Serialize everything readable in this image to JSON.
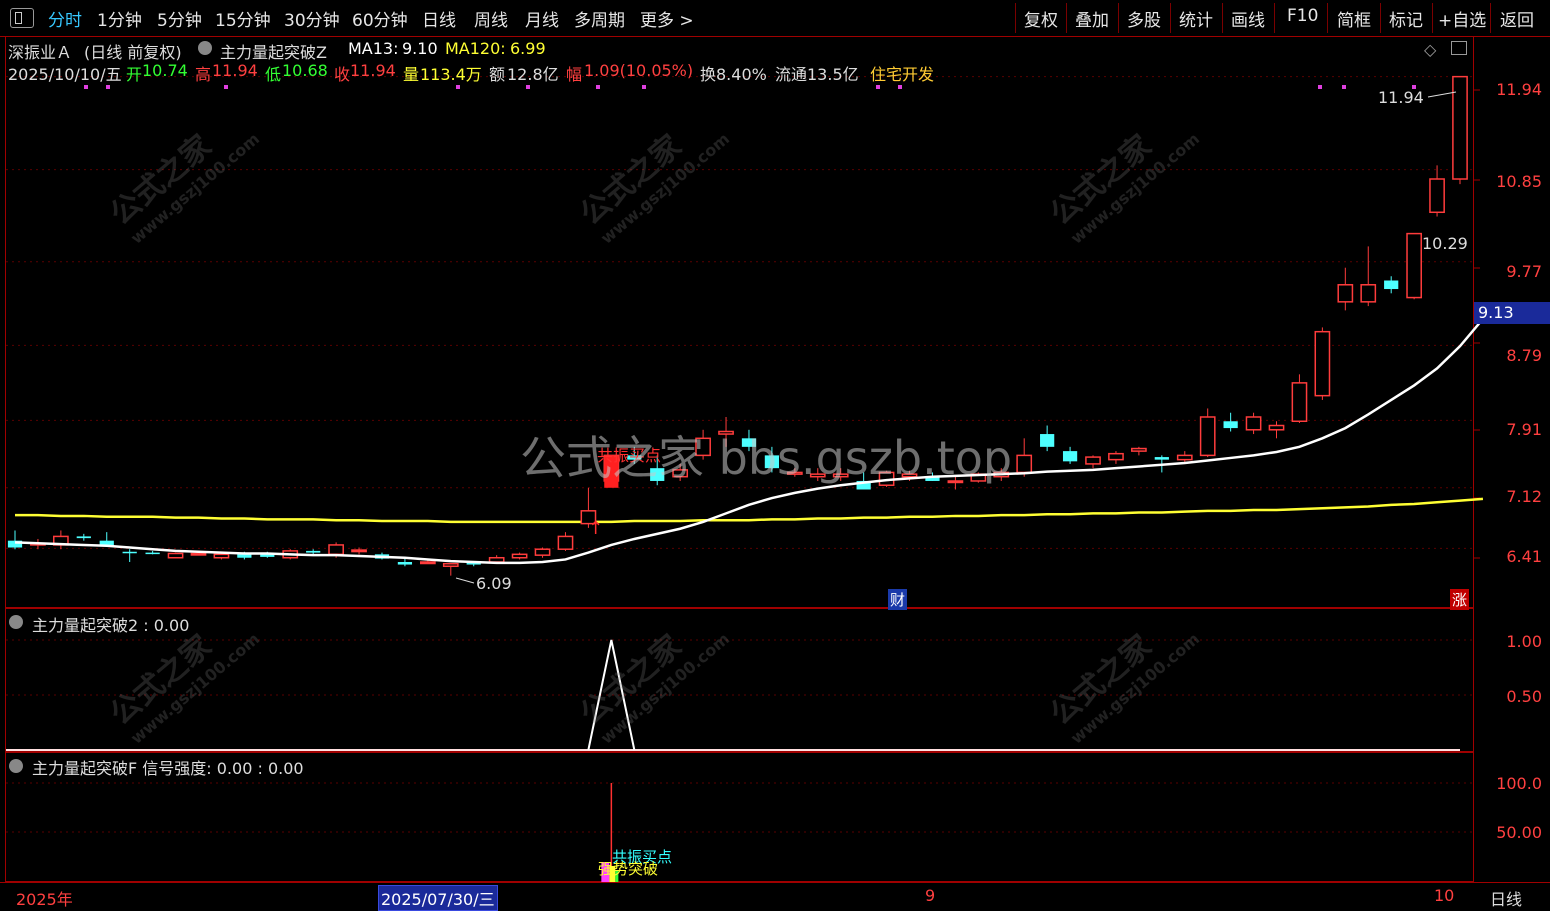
{
  "toolbar": {
    "left": [
      "分时",
      "1分钟",
      "5分钟",
      "15分钟",
      "30分钟",
      "60分钟",
      "日线",
      "周线",
      "月线",
      "多周期",
      "更多 >"
    ],
    "right": [
      "复权",
      "叠加",
      "多股",
      "统计",
      "画线",
      "F10",
      "简框",
      "标记",
      "+自选",
      "返回"
    ]
  },
  "header": {
    "stock_name": "深振业Ａ",
    "period": "(日线 前复权)",
    "indicator": "主力量起突破Z",
    "ma13_label": "MA13:",
    "ma13_value": "9.10",
    "ma120_label": "MA120:",
    "ma120_value": "6.99",
    "date": "2025/10/10/五",
    "open_label": "开",
    "open": "10.74",
    "high_label": "高",
    "high": "11.94",
    "low_label": "低",
    "low": "10.68",
    "close_label": "收",
    "close": "11.94",
    "vol_label": "量",
    "vol": "113.4万",
    "amt_label": "额",
    "amt": "12.8亿",
    "chg_label": "幅",
    "chg": "1.09(10.05%)",
    "turnover": "换8.40%",
    "float": "流通13.5亿",
    "sector": "住宅开发"
  },
  "axis": {
    "main": [
      "11.94",
      "10.85",
      "9.77",
      "8.79",
      "7.91",
      "7.12",
      "6.41"
    ],
    "current": "9.13",
    "ind1": [
      "1.00",
      "0.50"
    ],
    "ind2": [
      "100.0",
      "50.00"
    ]
  },
  "annotations": {
    "high_mark": "11.94",
    "low_mark": "6.09",
    "mid_mark": "10.29",
    "buy_label": "共振买点",
    "cai": "财",
    "zhang": "涨"
  },
  "ind1": {
    "title": "主力量起突破2 : 0.00"
  },
  "ind2": {
    "title": "主力量起突破F 信号强度: 0.00 : 0.00",
    "label_a": "共振买点",
    "label_b": "强势突破"
  },
  "bottom": {
    "year": "2025年",
    "cursor_date": "2025/07/30/三",
    "m9": "9",
    "m10": "10",
    "period": "日线"
  },
  "watermark": {
    "center": "公式之家 bbs.gszb.top",
    "tile": "公式之家",
    "tile_url": "www.gszj100.com"
  },
  "colors": {
    "up": "#ff3c3c",
    "down": "#4dffff",
    "ma13": "#ffffff",
    "ma120": "#ffff33",
    "frame": "#a00000"
  },
  "chart_data": {
    "type": "candlestick",
    "series": [
      {
        "o": 6.5,
        "h": 6.62,
        "l": 6.4,
        "c": 6.42
      },
      {
        "o": 6.45,
        "h": 6.52,
        "l": 6.4,
        "c": 6.47
      },
      {
        "o": 6.45,
        "h": 6.62,
        "l": 6.4,
        "c": 6.55
      },
      {
        "o": 6.55,
        "h": 6.58,
        "l": 6.5,
        "c": 6.53
      },
      {
        "o": 6.5,
        "h": 6.6,
        "l": 6.44,
        "c": 6.44
      },
      {
        "o": 6.37,
        "h": 6.4,
        "l": 6.25,
        "c": 6.36
      },
      {
        "o": 6.36,
        "h": 6.38,
        "l": 6.34,
        "c": 6.35
      },
      {
        "o": 6.3,
        "h": 6.36,
        "l": 6.3,
        "c": 6.35
      },
      {
        "o": 6.35,
        "h": 6.37,
        "l": 6.33,
        "c": 6.35
      },
      {
        "o": 6.3,
        "h": 6.37,
        "l": 6.28,
        "c": 6.34
      },
      {
        "o": 6.35,
        "h": 6.37,
        "l": 6.28,
        "c": 6.3
      },
      {
        "o": 6.34,
        "h": 6.37,
        "l": 6.3,
        "c": 6.31
      },
      {
        "o": 6.3,
        "h": 6.4,
        "l": 6.28,
        "c": 6.38
      },
      {
        "o": 6.38,
        "h": 6.4,
        "l": 6.34,
        "c": 6.36
      },
      {
        "o": 6.34,
        "h": 6.48,
        "l": 6.3,
        "c": 6.45
      },
      {
        "o": 6.38,
        "h": 6.42,
        "l": 6.34,
        "c": 6.39
      },
      {
        "o": 6.34,
        "h": 6.36,
        "l": 6.28,
        "c": 6.29
      },
      {
        "o": 6.25,
        "h": 6.3,
        "l": 6.2,
        "c": 6.22
      },
      {
        "o": 6.25,
        "h": 6.27,
        "l": 6.23,
        "c": 6.25
      },
      {
        "o": 6.2,
        "h": 6.23,
        "l": 6.09,
        "c": 6.23
      },
      {
        "o": 6.24,
        "h": 6.26,
        "l": 6.2,
        "c": 6.22
      },
      {
        "o": 6.25,
        "h": 6.33,
        "l": 6.24,
        "c": 6.3
      },
      {
        "o": 6.3,
        "h": 6.36,
        "l": 6.28,
        "c": 6.34
      },
      {
        "o": 6.33,
        "h": 6.42,
        "l": 6.3,
        "c": 6.4
      },
      {
        "o": 6.4,
        "h": 6.6,
        "l": 6.38,
        "c": 6.55
      },
      {
        "o": 6.7,
        "h": 7.12,
        "l": 6.65,
        "c": 6.85
      },
      {
        "o": 7.2,
        "h": 7.5,
        "l": 7.15,
        "c": 7.5
      },
      {
        "o": 7.5,
        "h": 7.6,
        "l": 7.4,
        "c": 7.45
      },
      {
        "o": 7.35,
        "h": 7.5,
        "l": 7.15,
        "c": 7.2
      },
      {
        "o": 7.25,
        "h": 7.4,
        "l": 7.2,
        "c": 7.33
      },
      {
        "o": 7.5,
        "h": 7.8,
        "l": 7.45,
        "c": 7.7
      },
      {
        "o": 7.75,
        "h": 7.95,
        "l": 7.6,
        "c": 7.78
      },
      {
        "o": 7.7,
        "h": 7.8,
        "l": 7.55,
        "c": 7.6
      },
      {
        "o": 7.5,
        "h": 7.6,
        "l": 7.3,
        "c": 7.35
      },
      {
        "o": 7.28,
        "h": 7.35,
        "l": 7.25,
        "c": 7.3
      },
      {
        "o": 7.25,
        "h": 7.35,
        "l": 7.2,
        "c": 7.28
      },
      {
        "o": 7.25,
        "h": 7.35,
        "l": 7.2,
        "c": 7.28
      },
      {
        "o": 7.2,
        "h": 7.3,
        "l": 7.1,
        "c": 7.1
      },
      {
        "o": 7.15,
        "h": 7.32,
        "l": 7.13,
        "c": 7.3
      },
      {
        "o": 7.25,
        "h": 7.32,
        "l": 7.2,
        "c": 7.28
      },
      {
        "o": 7.25,
        "h": 7.3,
        "l": 7.2,
        "c": 7.2
      },
      {
        "o": 7.2,
        "h": 7.25,
        "l": 7.1,
        "c": 7.2
      },
      {
        "o": 7.2,
        "h": 7.3,
        "l": 7.18,
        "c": 7.28
      },
      {
        "o": 7.25,
        "h": 7.35,
        "l": 7.2,
        "c": 7.3
      },
      {
        "o": 7.3,
        "h": 7.7,
        "l": 7.25,
        "c": 7.5
      },
      {
        "o": 7.75,
        "h": 7.85,
        "l": 7.55,
        "c": 7.6
      },
      {
        "o": 7.55,
        "h": 7.6,
        "l": 7.4,
        "c": 7.43
      },
      {
        "o": 7.4,
        "h": 7.5,
        "l": 7.35,
        "c": 7.48
      },
      {
        "o": 7.45,
        "h": 7.55,
        "l": 7.4,
        "c": 7.52
      },
      {
        "o": 7.55,
        "h": 7.6,
        "l": 7.5,
        "c": 7.58
      },
      {
        "o": 7.48,
        "h": 7.5,
        "l": 7.3,
        "c": 7.45
      },
      {
        "o": 7.45,
        "h": 7.55,
        "l": 7.4,
        "c": 7.5
      },
      {
        "o": 7.5,
        "h": 8.05,
        "l": 7.48,
        "c": 7.95
      },
      {
        "o": 7.9,
        "h": 8.0,
        "l": 7.78,
        "c": 7.82
      },
      {
        "o": 7.8,
        "h": 8.0,
        "l": 7.75,
        "c": 7.95
      },
      {
        "o": 7.8,
        "h": 7.9,
        "l": 7.7,
        "c": 7.85
      },
      {
        "o": 7.9,
        "h": 8.45,
        "l": 7.88,
        "c": 8.35
      },
      {
        "o": 8.2,
        "h": 9.0,
        "l": 8.15,
        "c": 8.95
      },
      {
        "o": 9.3,
        "h": 9.7,
        "l": 9.2,
        "c": 9.5
      },
      {
        "o": 9.3,
        "h": 9.95,
        "l": 9.25,
        "c": 9.5
      },
      {
        "o": 9.55,
        "h": 9.6,
        "l": 9.4,
        "c": 9.45
      },
      {
        "o": 9.35,
        "h": 10.1,
        "l": 9.33,
        "c": 10.1
      },
      {
        "o": 10.35,
        "h": 10.9,
        "l": 10.3,
        "c": 10.74
      },
      {
        "o": 10.74,
        "h": 11.94,
        "l": 10.68,
        "c": 11.94
      }
    ],
    "ma13": [
      6.48,
      6.47,
      6.46,
      6.45,
      6.44,
      6.42,
      6.4,
      6.38,
      6.37,
      6.36,
      6.35,
      6.35,
      6.34,
      6.33,
      6.33,
      6.32,
      6.31,
      6.3,
      6.28,
      6.26,
      6.25,
      6.24,
      6.24,
      6.25,
      6.28,
      6.36,
      6.45,
      6.52,
      6.58,
      6.64,
      6.72,
      6.82,
      6.92,
      7.0,
      7.06,
      7.11,
      7.15,
      7.18,
      7.21,
      7.23,
      7.25,
      7.26,
      7.27,
      7.28,
      7.29,
      7.31,
      7.32,
      7.33,
      7.35,
      7.37,
      7.39,
      7.41,
      7.44,
      7.47,
      7.5,
      7.54,
      7.6,
      7.7,
      7.82,
      7.98,
      8.15,
      8.32,
      8.52,
      8.78,
      9.1
    ],
    "ma120": [
      6.8,
      6.8,
      6.79,
      6.79,
      6.78,
      6.78,
      6.78,
      6.77,
      6.77,
      6.76,
      6.76,
      6.75,
      6.75,
      6.75,
      6.74,
      6.74,
      6.73,
      6.73,
      6.73,
      6.72,
      6.72,
      6.72,
      6.72,
      6.72,
      6.72,
      6.72,
      6.72,
      6.73,
      6.73,
      6.73,
      6.74,
      6.74,
      6.74,
      6.75,
      6.75,
      6.76,
      6.76,
      6.77,
      6.77,
      6.78,
      6.78,
      6.79,
      6.79,
      6.8,
      6.8,
      6.81,
      6.81,
      6.82,
      6.82,
      6.83,
      6.83,
      6.84,
      6.85,
      6.85,
      6.86,
      6.86,
      6.87,
      6.88,
      6.89,
      6.9,
      6.92,
      6.93,
      6.95,
      6.97,
      6.99
    ],
    "ylim": [
      6.0,
      12.0
    ],
    "ind1_signal_index": 25,
    "ind2_signal_index": 25,
    "ind2_ylim": [
      0,
      100
    ]
  }
}
